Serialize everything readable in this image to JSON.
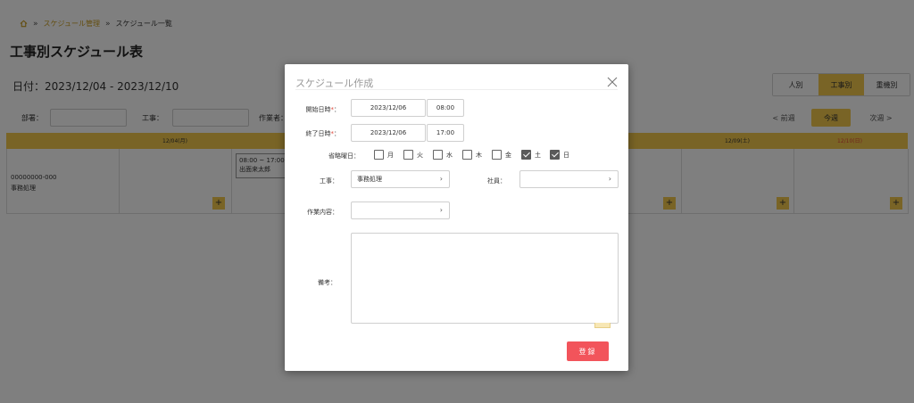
{
  "breadcrumb": {
    "link": "スケジュール管理",
    "current": "スケジュール一覧",
    "separator": "»"
  },
  "page": {
    "title": "工事別スケジュール表",
    "date_range": "日付：2023/12/04 - 2023/12/10"
  },
  "view_switch": {
    "options": [
      "人別",
      "工事別",
      "重機別"
    ],
    "active": "工事別"
  },
  "filters": {
    "department_label": "部署：",
    "construction_label": "工事：",
    "worker_label": "作業者："
  },
  "week_nav": {
    "prev": "< 前週",
    "this": "今週",
    "next": "次週 >"
  },
  "calendar": {
    "headers": [
      "12/04(月)",
      "",
      "",
      "",
      "",
      "12/09(土)",
      "12/10(日)"
    ],
    "row": {
      "code": "00000000-000",
      "name": "事務処理"
    },
    "event": {
      "time": "08:00 ~ 17:00",
      "person": "出面来太郎"
    },
    "add_symbol": "+"
  },
  "modal": {
    "title": "スケジュール作成",
    "start_label": "開始日時",
    "end_label": "終了日時",
    "required_mark": "*",
    "label_suffix": "：",
    "start_date": "2023/12/06",
    "start_time": "08:00",
    "end_date": "2023/12/06",
    "end_time": "17:00",
    "skip_days_label": "省略曜日：",
    "days": [
      {
        "label": "月",
        "checked": false
      },
      {
        "label": "火",
        "checked": false
      },
      {
        "label": "水",
        "checked": false
      },
      {
        "label": "木",
        "checked": false
      },
      {
        "label": "金",
        "checked": false
      },
      {
        "label": "土",
        "checked": true
      },
      {
        "label": "日",
        "checked": true
      }
    ],
    "construction_label": "工事：",
    "construction_value": "事務処理",
    "employee_label": "社員：",
    "employee_value": "",
    "work_label": "作業内容：",
    "work_value": "",
    "notes_label": "備考：",
    "notes_value": "",
    "submit_label": "登録"
  },
  "colors": {
    "accent": "#f2c94c",
    "danger": "#f2545b",
    "sunday": "#e0473a"
  }
}
